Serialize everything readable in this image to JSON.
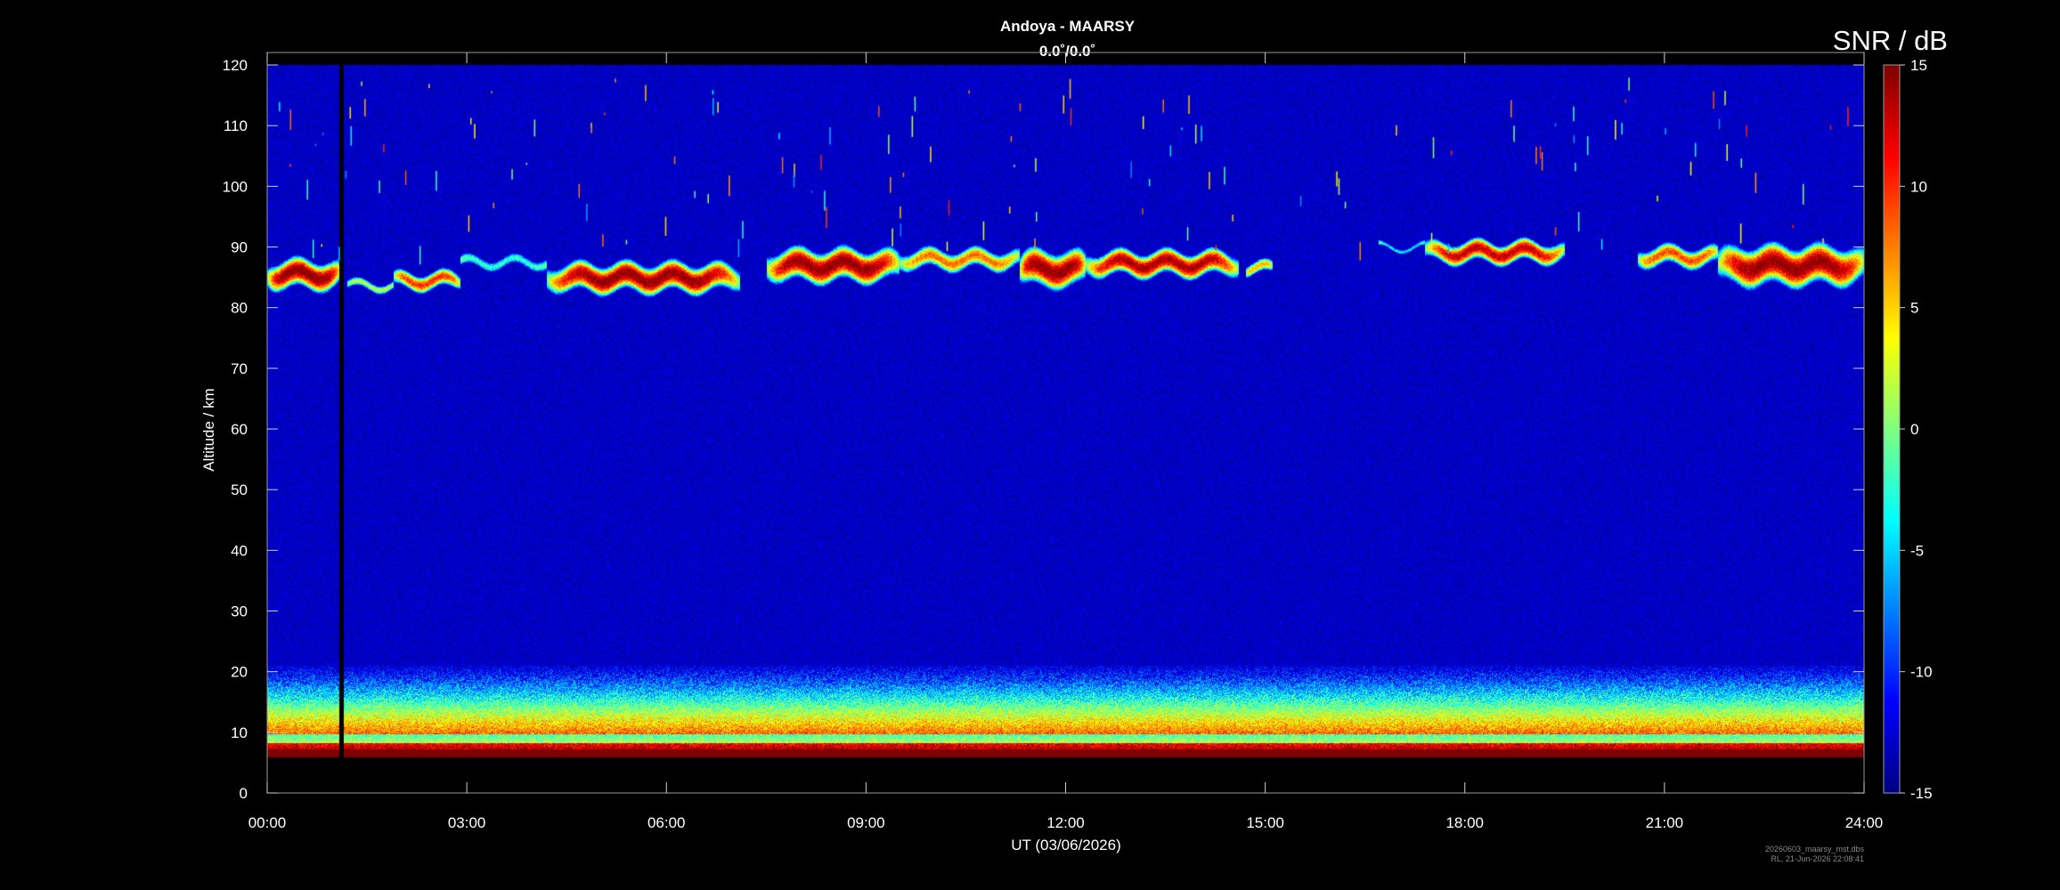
{
  "chart_data": {
    "type": "heatmap",
    "title": "Andoya - MAARSY",
    "subtitle": "0.0˚/0.0˚",
    "xlabel": "UT (03/06/2026)",
    "ylabel": "Altitude / km",
    "x_ticks": [
      "00:00",
      "03:00",
      "06:00",
      "09:00",
      "12:00",
      "15:00",
      "18:00",
      "21:00",
      "24:00"
    ],
    "xlim_hours": [
      0,
      24
    ],
    "ylim": [
      0,
      120
    ],
    "y_ticks": [
      0,
      10,
      20,
      30,
      40,
      50,
      60,
      70,
      80,
      90,
      100,
      110,
      120
    ],
    "colorbar": {
      "label": "SNR / dB",
      "range": [
        -15,
        15
      ],
      "ticks": [
        15,
        10,
        5,
        0,
        -5,
        -10,
        -15
      ],
      "colormap": "jet"
    },
    "data_extent_km": [
      6,
      120
    ],
    "data_gap": {
      "start_hour": 1.08,
      "end_hour": 1.15
    },
    "background_snr_db": -13,
    "pmse_layers": [
      {
        "start_hour": 0.0,
        "end_hour": 1.1,
        "center_km": 85.5,
        "thickness_km": 4,
        "max_snr_db": 15
      },
      {
        "start_hour": 1.2,
        "end_hour": 1.9,
        "center_km": 83.7,
        "thickness_km": 1.5,
        "max_snr_db": 2
      },
      {
        "start_hour": 1.9,
        "end_hour": 2.9,
        "center_km": 84.5,
        "thickness_km": 2.5,
        "max_snr_db": 10
      },
      {
        "start_hour": 2.9,
        "end_hour": 4.2,
        "center_km": 87.5,
        "thickness_km": 2,
        "max_snr_db": -2
      },
      {
        "start_hour": 4.2,
        "end_hour": 7.1,
        "center_km": 85,
        "thickness_km": 4,
        "max_snr_db": 15
      },
      {
        "start_hour": 7.5,
        "end_hour": 9.5,
        "center_km": 87,
        "thickness_km": 4.5,
        "max_snr_db": 15
      },
      {
        "start_hour": 9.5,
        "end_hour": 11.3,
        "center_km": 88,
        "thickness_km": 3,
        "max_snr_db": 8
      },
      {
        "start_hour": 11.3,
        "end_hour": 12.3,
        "center_km": 86.5,
        "thickness_km": 5,
        "max_snr_db": 15
      },
      {
        "start_hour": 12.3,
        "end_hour": 14.6,
        "center_km": 87.3,
        "thickness_km": 3.5,
        "max_snr_db": 14
      },
      {
        "start_hour": 14.7,
        "end_hour": 15.1,
        "center_km": 86.5,
        "thickness_km": 2,
        "max_snr_db": 6
      },
      {
        "start_hour": 16.7,
        "end_hour": 17.4,
        "center_km": 90,
        "thickness_km": 1,
        "max_snr_db": -4
      },
      {
        "start_hour": 17.4,
        "end_hour": 19.5,
        "center_km": 89.2,
        "thickness_km": 3,
        "max_snr_db": 13
      },
      {
        "start_hour": 20.6,
        "end_hour": 21.8,
        "center_km": 88.5,
        "thickness_km": 3,
        "max_snr_db": 9
      },
      {
        "start_hour": 21.8,
        "end_hour": 24.0,
        "center_km": 87,
        "thickness_km": 5.5,
        "max_snr_db": 15
      }
    ],
    "tropospheric_layer": {
      "bottom_km": 6,
      "top_km": 21,
      "max_snr_db": 15
    }
  },
  "footer": {
    "filename": "20260603_maarsy_mst.dbs",
    "created": "RL, 21-Jun-2026 22:08:41"
  }
}
